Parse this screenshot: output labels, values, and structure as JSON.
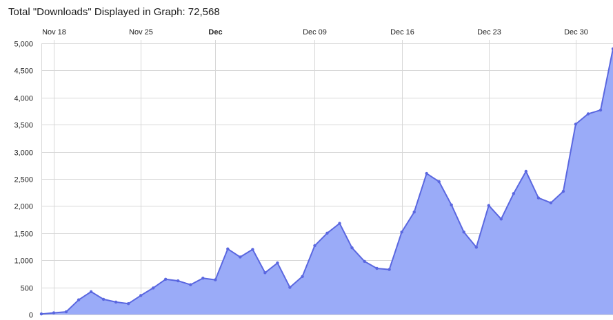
{
  "header": {
    "title": "Total \"Downloads\" Displayed in Graph: 72,568"
  },
  "chart_data": {
    "type": "area",
    "title": "Total \"Downloads\" Displayed in Graph: 72,568",
    "xlabel": "",
    "ylabel": "",
    "ylim": [
      0,
      5000
    ],
    "xlim": [
      "2012-11-18",
      "2013-01-02"
    ],
    "grid": true,
    "x_ticks": [
      {
        "label": "Nov 18",
        "date": "2012-11-18",
        "bold": false
      },
      {
        "label": "Nov 25",
        "date": "2012-11-25",
        "bold": false
      },
      {
        "label": "Dec",
        "date": "2012-12-01",
        "bold": true
      },
      {
        "label": "Dec 09",
        "date": "2012-12-09",
        "bold": false
      },
      {
        "label": "Dec 16",
        "date": "2012-12-16",
        "bold": false
      },
      {
        "label": "Dec 23",
        "date": "2012-12-23",
        "bold": false
      },
      {
        "label": "Dec 30",
        "date": "2012-12-30",
        "bold": false
      }
    ],
    "y_ticks": [
      {
        "label": "0",
        "value": 0
      },
      {
        "label": "500",
        "value": 500
      },
      {
        "label": "1,000",
        "value": 1000
      },
      {
        "label": "1,500",
        "value": 1500
      },
      {
        "label": "2,000",
        "value": 2000
      },
      {
        "label": "2,500",
        "value": 2500
      },
      {
        "label": "3,000",
        "value": 3000
      },
      {
        "label": "3,500",
        "value": 3500
      },
      {
        "label": "4,000",
        "value": 4000
      },
      {
        "label": "4,500",
        "value": 4500
      },
      {
        "label": "5,000",
        "value": 5000
      }
    ],
    "colors": {
      "line": "#5a67e0",
      "fill": "#9aabf8",
      "grid": "#d7d7d7"
    },
    "series": [
      {
        "x": [
          "2012-11-17",
          "2012-11-18",
          "2012-11-19",
          "2012-11-20",
          "2012-11-21",
          "2012-11-22",
          "2012-11-23",
          "2012-11-24",
          "2012-11-25",
          "2012-11-26",
          "2012-11-27",
          "2012-11-28",
          "2012-11-29",
          "2012-11-30",
          "2012-12-01",
          "2012-12-02",
          "2012-12-03",
          "2012-12-04",
          "2012-12-05",
          "2012-12-06",
          "2012-12-07",
          "2012-12-08",
          "2012-12-09",
          "2012-12-10",
          "2012-12-11",
          "2012-12-12",
          "2012-12-13",
          "2012-12-14",
          "2012-12-15",
          "2012-12-16",
          "2012-12-17",
          "2012-12-18",
          "2012-12-19",
          "2012-12-20",
          "2012-12-21",
          "2012-12-22",
          "2012-12-23",
          "2012-12-24",
          "2012-12-25",
          "2012-12-26",
          "2012-12-27",
          "2012-12-28",
          "2012-12-29",
          "2012-12-30",
          "2012-12-31",
          "2013-01-01",
          "2013-01-02"
        ],
        "values": [
          10,
          30,
          50,
          270,
          420,
          280,
          230,
          200,
          350,
          490,
          650,
          620,
          550,
          670,
          640,
          1210,
          1060,
          1200,
          770,
          950,
          500,
          700,
          1270,
          1500,
          1680,
          1230,
          980,
          850,
          830,
          1520,
          1890,
          2600,
          2450,
          2020,
          1520,
          1240,
          2010,
          1760,
          2230,
          2640,
          2150,
          2060,
          2270,
          3510,
          3700,
          3770,
          4900
        ]
      }
    ]
  }
}
